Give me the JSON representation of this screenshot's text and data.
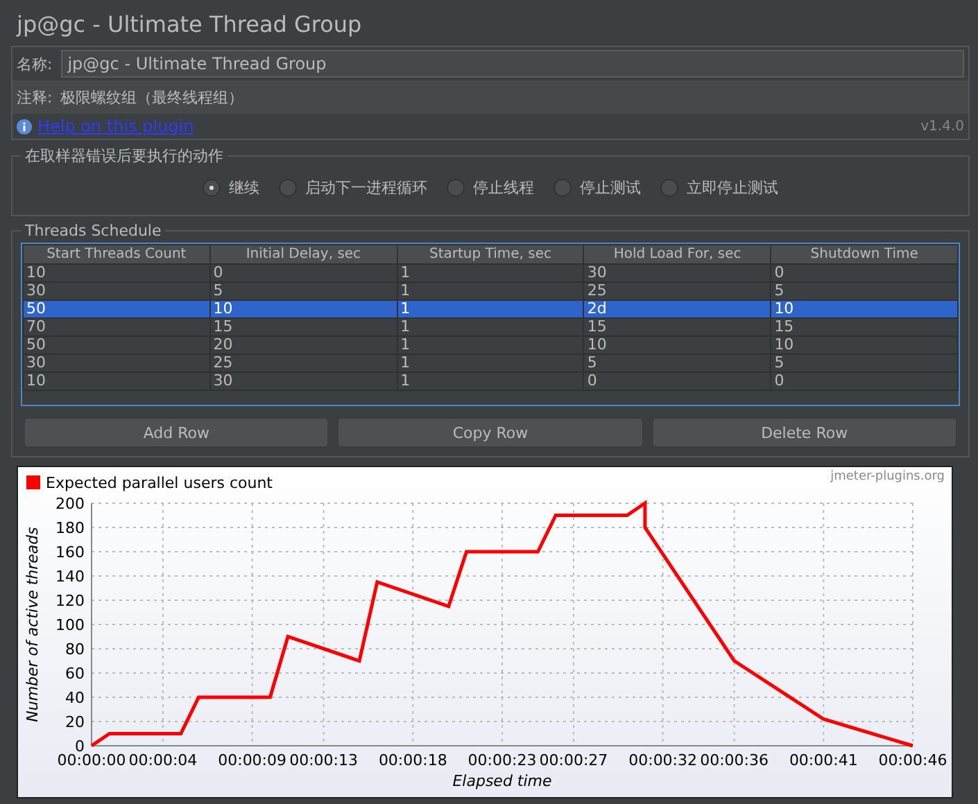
{
  "window": {
    "title": "jp@gc - Ultimate Thread Group"
  },
  "name_field": {
    "label": "名称:",
    "value": "jp@gc - Ultimate Thread Group"
  },
  "comment": {
    "label": "注释:",
    "value": "极限螺纹组（最终线程组）"
  },
  "help_link": "Help on this plugin",
  "version": "v1.4.0",
  "error_action": {
    "title": "在取样器错误后要执行的动作",
    "options": [
      {
        "label": "继续",
        "selected": true
      },
      {
        "label": "启动下一进程循环",
        "selected": false
      },
      {
        "label": "停止线程",
        "selected": false
      },
      {
        "label": "停止测试",
        "selected": false
      },
      {
        "label": "立即停止测试",
        "selected": false
      }
    ]
  },
  "threads_schedule": {
    "title": "Threads Schedule",
    "columns": [
      "Start Threads Count",
      "Initial Delay, sec",
      "Startup Time, sec",
      "Hold Load For, sec",
      "Shutdown Time"
    ],
    "rows": [
      {
        "cells": [
          "10",
          "0",
          "1",
          "30",
          "0"
        ],
        "selected": false
      },
      {
        "cells": [
          "30",
          "5",
          "1",
          "25",
          "5"
        ],
        "selected": false
      },
      {
        "cells": [
          "50",
          "10",
          "1",
          "2d",
          "10"
        ],
        "selected": true
      },
      {
        "cells": [
          "70",
          "15",
          "1",
          "15",
          "15"
        ],
        "selected": false
      },
      {
        "cells": [
          "50",
          "20",
          "1",
          "10",
          "10"
        ],
        "selected": false
      },
      {
        "cells": [
          "30",
          "25",
          "1",
          "5",
          "5"
        ],
        "selected": false
      },
      {
        "cells": [
          "10",
          "30",
          "1",
          "0",
          "0"
        ],
        "selected": false
      }
    ]
  },
  "buttons": [
    "Add Row",
    "Copy Row",
    "Delete Row"
  ],
  "chart": {
    "credit": "jmeter-plugins.org",
    "chart_data": {
      "type": "line",
      "xlabel": "Elapsed time",
      "ylabel": "Number of active threads",
      "x": [
        0,
        1,
        5,
        6,
        10,
        11,
        15,
        16,
        20,
        21,
        25,
        26,
        30,
        31,
        31,
        36,
        41,
        46
      ],
      "series": [
        {
          "name": "Expected parallel users count",
          "color": "#ff0000",
          "values": [
            0,
            10,
            10,
            40,
            40,
            90,
            70,
            135,
            115,
            160,
            160,
            190,
            190,
            200,
            180,
            70,
            22,
            0
          ]
        }
      ],
      "xlim": [
        0,
        46
      ],
      "ylim": [
        0,
        200
      ],
      "grid": true,
      "xticks": [
        {
          "value": 0,
          "label": "00:00:00"
        },
        {
          "value": 4,
          "label": "00:00:04"
        },
        {
          "value": 9,
          "label": "00:00:09"
        },
        {
          "value": 13,
          "label": "00:00:13"
        },
        {
          "value": 18,
          "label": "00:00:18"
        },
        {
          "value": 23,
          "label": "00:00:23"
        },
        {
          "value": 27,
          "label": "00:00:27"
        },
        {
          "value": 32,
          "label": "00:00:32"
        },
        {
          "value": 36,
          "label": "00:00:36"
        },
        {
          "value": 41,
          "label": "00:00:41"
        },
        {
          "value": 46,
          "label": "00:00:46"
        }
      ],
      "yticks": [
        0,
        20,
        40,
        60,
        80,
        100,
        120,
        140,
        160,
        180,
        200
      ]
    }
  }
}
